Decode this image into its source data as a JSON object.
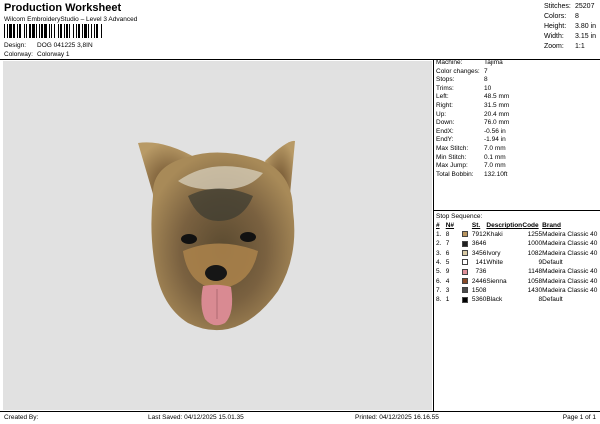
{
  "header": {
    "title": "Production Worksheet",
    "subtitle": "Wilcom EmbroideryStudio – Level 3 Advanced",
    "design_label": "Design:",
    "design_value": "DOG 041225 3,8IN",
    "colorway_label": "Colorway:",
    "colorway_value": "Colorway 1"
  },
  "summary": [
    {
      "label": "Stitches:",
      "value": "25207"
    },
    {
      "label": "Colors:",
      "value": "8"
    },
    {
      "label": "Height:",
      "value": "3.80 in"
    },
    {
      "label": "Width:",
      "value": "3.15 in"
    },
    {
      "label": "Zoom:",
      "value": "1:1"
    }
  ],
  "specs": [
    {
      "label": "Machine:",
      "value": "Tajima"
    },
    {
      "label": "Color changes:",
      "value": "7"
    },
    {
      "label": "Stops:",
      "value": "8"
    },
    {
      "label": "Trims:",
      "value": "10"
    },
    {
      "label": "Left:",
      "value": "48.5 mm"
    },
    {
      "label": "Right:",
      "value": "31.5 mm"
    },
    {
      "label": "Up:",
      "value": "20.4 mm"
    },
    {
      "label": "Down:",
      "value": "76.0 mm"
    },
    {
      "label": "EndX:",
      "value": "-0.56 in"
    },
    {
      "label": "EndY:",
      "value": "-1.94 in"
    },
    {
      "label": "Max Stitch:",
      "value": "7.0 mm"
    },
    {
      "label": "Min Stitch:",
      "value": "0.1 mm"
    },
    {
      "label": "Max Jump:",
      "value": "7.0 mm"
    },
    {
      "label": "Total Bobbin:",
      "value": "132.10ft"
    }
  ],
  "stops": {
    "title": "Stop Sequence:",
    "headers": {
      "num": "#",
      "n": "N#",
      "st": "St.",
      "desc": "Description",
      "code": "Code",
      "brand": "Brand"
    },
    "rows": [
      {
        "num": "1.",
        "n": "8",
        "color": "#b9955f",
        "st": "7912",
        "desc": "Khaki",
        "code": "1255",
        "brand": "Madeira Classic 40"
      },
      {
        "num": "2.",
        "n": "7",
        "color": "#1f1f1f",
        "st": "3646",
        "desc": "",
        "code": "1000",
        "brand": "Madeira Classic 40"
      },
      {
        "num": "3.",
        "n": "6",
        "color": "#d8c9a4",
        "st": "3456",
        "desc": "Ivory",
        "code": "1082",
        "brand": "Madeira Classic 40"
      },
      {
        "num": "4.",
        "n": "5",
        "color": "#ffffff",
        "st": "141",
        "desc": "White",
        "code": "9",
        "brand": "Default"
      },
      {
        "num": "5.",
        "n": "9",
        "color": "#e0909a",
        "st": "736",
        "desc": "",
        "code": "1148",
        "brand": "Madeira Classic 40"
      },
      {
        "num": "6.",
        "n": "4",
        "color": "#8a4a28",
        "st": "2446",
        "desc": "Sienna",
        "code": "1058",
        "brand": "Madeira Classic 40"
      },
      {
        "num": "7.",
        "n": "3",
        "color": "#4a4a4a",
        "st": "1508",
        "desc": "",
        "code": "1430",
        "brand": "Madeira Classic 40"
      },
      {
        "num": "8.",
        "n": "1",
        "color": "#000000",
        "st": "5360",
        "desc": "Black",
        "code": "8",
        "brand": "Default"
      }
    ]
  },
  "footer": {
    "created": "Created By:",
    "saved": "Last Saved: 04/12/2025 15.01.35",
    "printed": "Printed: 04/12/2025 16.16.55",
    "page": "Page 1 of 1"
  }
}
